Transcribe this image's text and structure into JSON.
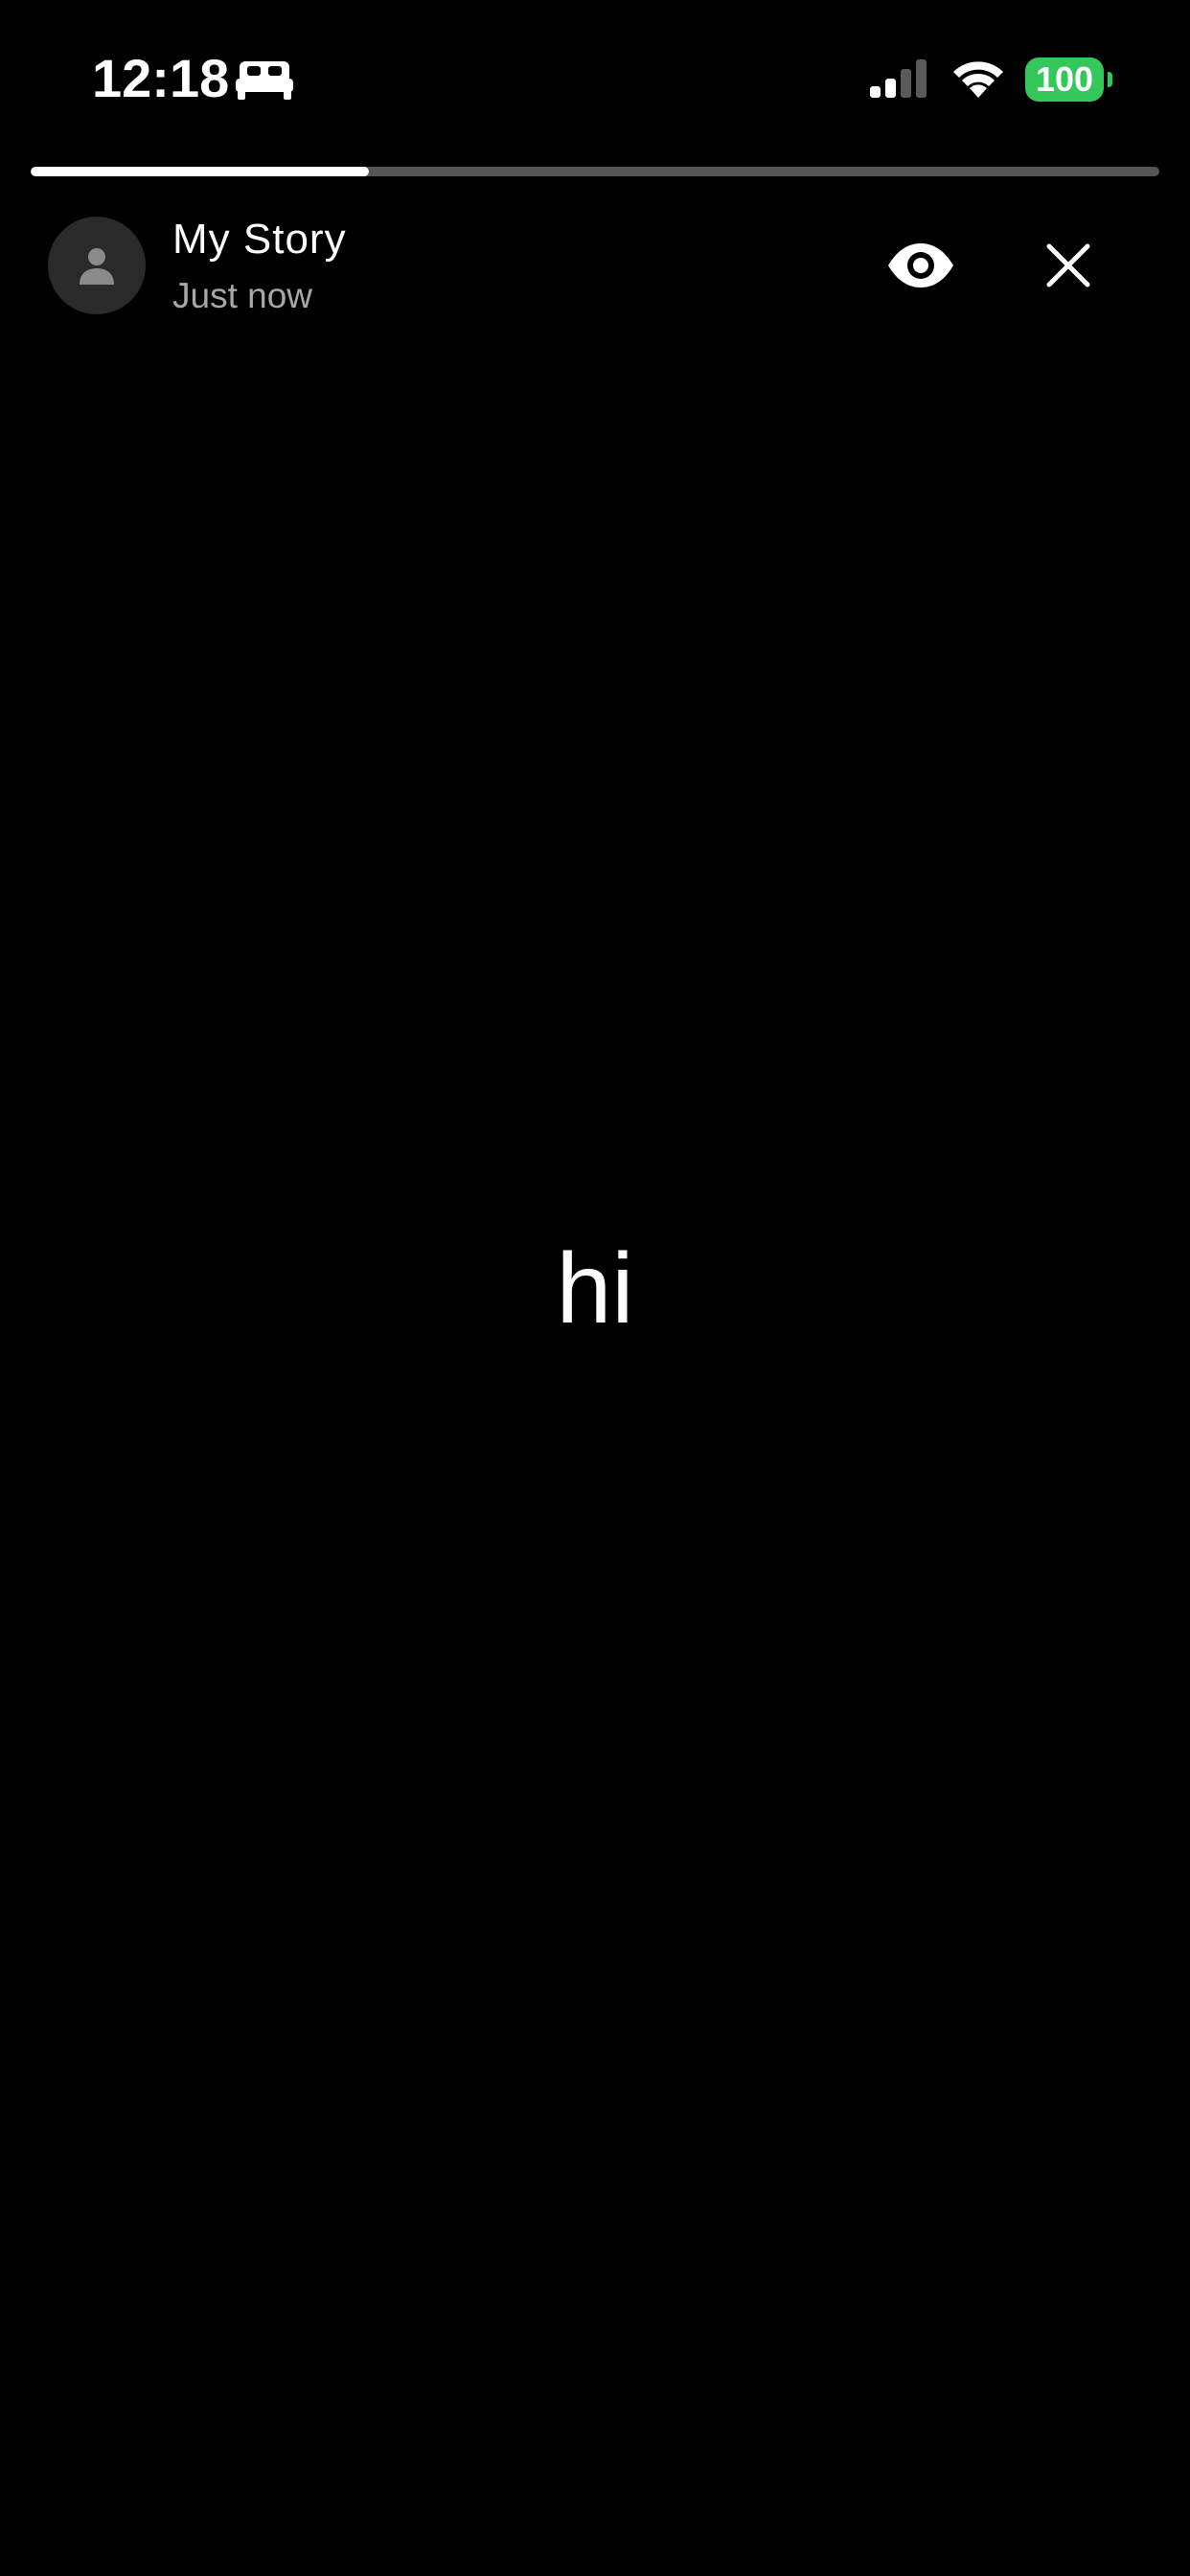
{
  "status_bar": {
    "time": "12:18",
    "battery_level": "100",
    "signal_bars_active": 2,
    "signal_bars_total": 4,
    "focus_icon": "bed-icon",
    "colors": {
      "battery": "#34c759"
    }
  },
  "story": {
    "progress_fraction": 0.3,
    "title": "My Story",
    "timestamp": "Just now",
    "text": "hi",
    "icons": {
      "avatar": "person-icon",
      "views": "eye-icon",
      "close": "close-icon"
    }
  }
}
